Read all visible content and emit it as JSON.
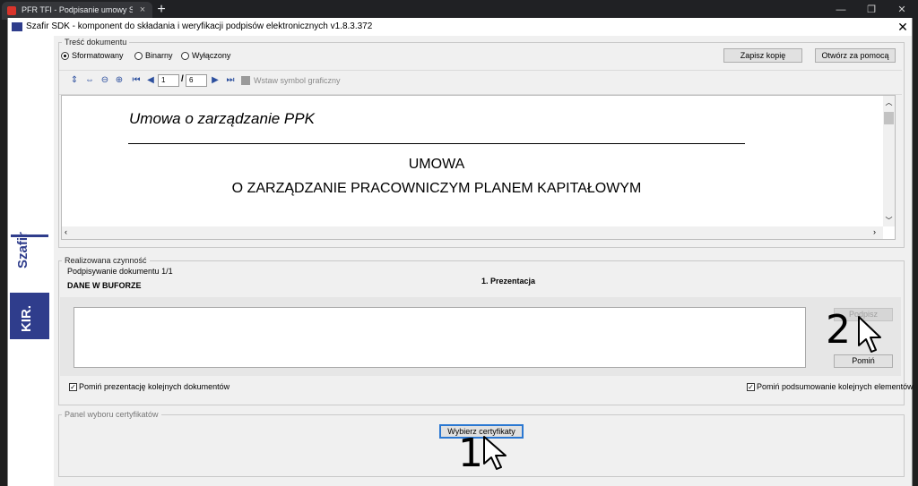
{
  "browser": {
    "tab_title": "PFR TFI - Podpisanie umowy Sz",
    "tab_close": "×",
    "new_tab": "+",
    "minimize": "—",
    "restore": "❐",
    "close": "✕"
  },
  "dialog": {
    "title": "Szafir SDK - komponent do składania i weryfikacji podpisów elektronicznych v1.8.3.372",
    "close": "✕"
  },
  "branding": {
    "product": "Szafir",
    "company": "KIR."
  },
  "document_section": {
    "legend": "Treść dokumentu",
    "radio_options": [
      {
        "label": "Sformatowany",
        "selected": true
      },
      {
        "label": "Binarny",
        "selected": false
      },
      {
        "label": "Wyłączony",
        "selected": false
      }
    ],
    "save_copy_button": "Zapisz kopię",
    "open_with_button": "Otwórz za pomocą",
    "toolbar": {
      "current_page": "1",
      "total_pages": "/",
      "page_count": "6",
      "insert_symbol": "Wstaw symbol graficzny"
    },
    "content": {
      "heading": "Umowa o zarządzanie PPK",
      "line1": "UMOWA",
      "line2": "O ZARZĄDZANIE PRACOWNICZYM PLANEM KAPITAŁOWYM"
    }
  },
  "action_section": {
    "legend": "Realizowana czynność",
    "signing_label": "Podpisywanie dokumentu 1/1",
    "buffer_label": "DANE W BUFORZE",
    "presentation_label": "1. Prezentacja",
    "sign_button": "Podpisz",
    "skip_button": "Pomiń",
    "skip_presentation_checkbox": "Pomiń prezentację kolejnych dokumentów",
    "skip_summary_checkbox": "Pomiń podsumowanie kolejnych elementów",
    "annotation_number": "2"
  },
  "certificate_section": {
    "legend": "Panel wyboru certyfikatów",
    "choose_button": "Wybierz certyfikaty",
    "annotation_number": "1"
  },
  "colors": {
    "brand_blue": "#2f3d8c",
    "dialog_bg": "#f0f0f0",
    "button_focus": "#2b78d2"
  }
}
